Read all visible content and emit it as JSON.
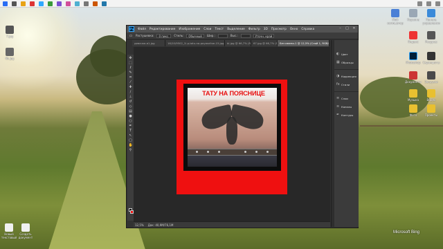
{
  "desktop": {
    "left_icons": [
      {
        "label": "7.jpg"
      },
      {
        "label": "6b.jpg"
      }
    ],
    "bottom_icons": [
      {
        "label": "Новый текстовый"
      },
      {
        "label": "Создать документ"
      }
    ],
    "right_icons": [
      {
        "label": "Мой компьютер"
      },
      {
        "label": "Корзина"
      },
      {
        "label": "Панель управления"
      },
      {
        "label": "Яндекс"
      },
      {
        "label": "Ресурсы"
      },
      {
        "label": "Photoshop"
      },
      {
        "label": "Скриншоты"
      },
      {
        "label": "Документы"
      },
      {
        "label": "Загрузки"
      },
      {
        "label": "Музыка"
      },
      {
        "label": "Видео"
      },
      {
        "label": "Фото"
      },
      {
        "label": "Проекты"
      },
      {
        "label": "Архив"
      },
      {
        "label": "Работа"
      },
      {
        "label": "Новая папка"
      }
    ],
    "watermark": "Microsoft Bing"
  },
  "photoshop": {
    "logo": "Ps",
    "menu": [
      "Файл",
      "Редактирование",
      "Изображение",
      "Слои",
      "Текст",
      "Выделение",
      "Фильтр",
      "3D",
      "Просмотр",
      "Окно",
      "Справка"
    ],
    "options": {
      "label1": "Растушевка:",
      "value1": "0 пикс.",
      "label2": "Стиль:",
      "value2": "Обычный",
      "label3": "Шир.:",
      "label4": "Выс.:",
      "button": "Уточн. край"
    },
    "tabs": [
      {
        "label": "девочка-в1.jpg",
        "active": false
      },
      {
        "label": "16/10/9502_1l-p-tatu-na-poyasnitse-15.jpg",
        "active": false
      },
      {
        "label": "bl.jpg @ 66,7% (RGB/8)",
        "active": false
      },
      {
        "label": "67.jpg @ 66,7% (RGB/8)",
        "active": false
      },
      {
        "label": "Без имени-1 @ 12,5% (Слой 1, RGB/8)",
        "active": true
      }
    ],
    "status": {
      "zoom": "12,5%",
      "doc": "Док: 40,9M/76,1M"
    },
    "panels": [
      {
        "label": "Цвет",
        "icon": "color-icon"
      },
      {
        "label": "Образцы",
        "icon": "swatches-icon"
      },
      {
        "label": "Коррекция",
        "icon": "adjustments-icon"
      },
      {
        "label": "Стили",
        "icon": "styles-icon"
      },
      {
        "label": "Слои",
        "icon": "layers-icon"
      },
      {
        "label": "Каналы",
        "icon": "channels-icon"
      },
      {
        "label": "Контуры",
        "icon": "paths-icon"
      }
    ]
  },
  "artwork": {
    "title": "ТАТУ НА ПОЯСНИЦЕ",
    "colors": {
      "frame": "#ef1010",
      "inner": "#0c0c0c",
      "text": "#e81010"
    }
  }
}
